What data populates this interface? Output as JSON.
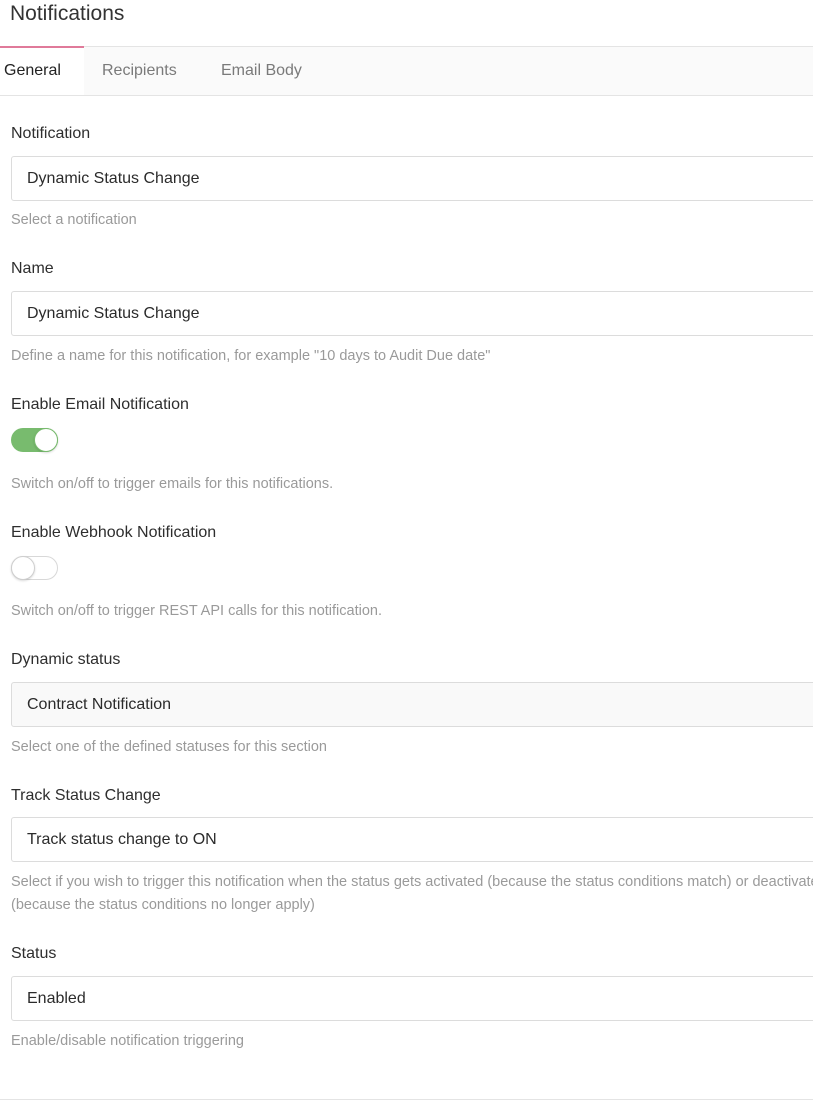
{
  "page": {
    "title": "Notifications"
  },
  "tabs": [
    {
      "label": "General",
      "active": true
    },
    {
      "label": "Recipients",
      "active": false
    },
    {
      "label": "Email Body",
      "active": false
    }
  ],
  "form": {
    "notification": {
      "label": "Notification",
      "value": "Dynamic Status Change",
      "help": "Select a notification"
    },
    "name": {
      "label": "Name",
      "value": "Dynamic Status Change",
      "help": "Define a name for this notification, for example \"10 days to Audit Due date\""
    },
    "email_notification": {
      "label": "Enable Email Notification",
      "enabled": true,
      "help": "Switch on/off to trigger emails for this notifications."
    },
    "webhook_notification": {
      "label": "Enable Webhook Notification",
      "enabled": false,
      "help": "Switch on/off to trigger REST API calls for this notification."
    },
    "dynamic_status": {
      "label": "Dynamic status",
      "value": "Contract Notification",
      "help": "Select one of the defined statuses for this section"
    },
    "track_status_change": {
      "label": "Track Status Change",
      "value": "Track status change to ON",
      "help": "Select if you wish to trigger this notification when the status gets activated (because the status conditions match) or deactivated (because the status conditions no longer apply)"
    },
    "status": {
      "label": "Status",
      "value": "Enabled",
      "help": "Enable/disable notification triggering"
    }
  },
  "colors": {
    "accent_tab": "#e07a9a",
    "toggle_on": "#78bb6e"
  }
}
